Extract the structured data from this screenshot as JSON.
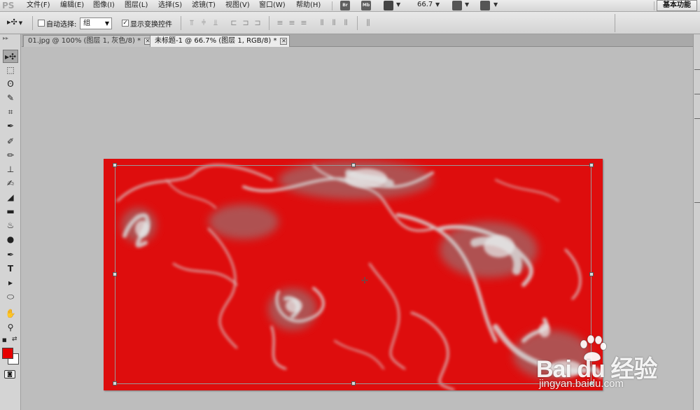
{
  "app": {
    "logo": "PS",
    "menu": [
      "文件(F)",
      "编辑(E)",
      "图像(I)",
      "图层(L)",
      "选择(S)",
      "滤镜(T)",
      "视图(V)",
      "窗口(W)",
      "帮助(H)"
    ],
    "bridge_icon": "Br",
    "minibridge_icon": "Mb",
    "zoom": "66.7",
    "workspace": "基本功能"
  },
  "options": {
    "auto_select_label": "自动选择:",
    "auto_select_checked": false,
    "auto_select_value": "组",
    "show_transform_label": "显示变换控件",
    "show_transform_checked": true
  },
  "tabs": [
    {
      "label": "01.jpg @ 100% (图层 1, 灰色/8) *",
      "active": false
    },
    {
      "label": "未标题-1 @ 66.7% (图层 1, RGB/8) *",
      "active": true
    }
  ],
  "tools": [
    "move-tool",
    "marquee-tool",
    "lasso-tool",
    "quick-selection-tool",
    "crop-tool",
    "eyedropper-tool",
    "spot-healing-tool",
    "brush-tool",
    "clone-stamp-tool",
    "history-brush-tool",
    "eraser-tool",
    "gradient-tool",
    "blur-tool",
    "dodge-tool",
    "pen-tool",
    "type-tool",
    "path-selection-tool",
    "shape-tool",
    "hand-tool",
    "zoom-tool"
  ],
  "colors": {
    "foreground": "#e60000",
    "background": "#ffffff",
    "document_fill": "#de0d0d"
  },
  "watermark": {
    "brand": "Bai du 经验",
    "url": "jingyan.baidu.com"
  }
}
